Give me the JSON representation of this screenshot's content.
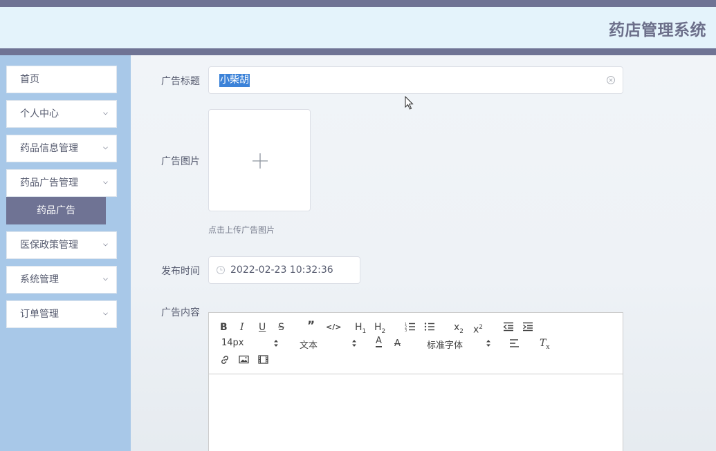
{
  "header": {
    "title": "药店管理系统"
  },
  "sidebar": {
    "items": [
      {
        "label": "首页",
        "expandable": false
      },
      {
        "label": "个人中心",
        "expandable": true
      },
      {
        "label": "药品信息管理",
        "expandable": true
      },
      {
        "label": "药品广告管理",
        "expandable": true
      },
      {
        "label": "医保政策管理",
        "expandable": true
      },
      {
        "label": "系统管理",
        "expandable": true
      },
      {
        "label": "订单管理",
        "expandable": true
      }
    ],
    "active_sub": {
      "label": "药品广告"
    }
  },
  "form": {
    "title_label": "广告标题",
    "title_value": "小柴胡",
    "image_label": "广告图片",
    "image_hint": "点击上传广告图片",
    "time_label": "发布时间",
    "time_value": "2022-02-23 10:32:36",
    "content_label": "广告内容"
  },
  "editor": {
    "font_size": "14px",
    "header_type": "文本",
    "font_family": "标准字体",
    "tools": [
      "bold-icon",
      "italic-icon",
      "underline-icon",
      "strikethrough-icon",
      "blockquote-icon",
      "code-block-icon",
      "h1-icon",
      "h2-icon",
      "ordered-list-icon",
      "bullet-list-icon",
      "subscript-icon",
      "superscript-icon",
      "outdent-icon",
      "indent-icon",
      "font-color-icon",
      "background-color-icon",
      "align-icon",
      "clear-format-icon",
      "link-icon",
      "image-icon",
      "video-icon"
    ]
  },
  "colors": {
    "accent": "#6f7394",
    "header_bg": "#e4f3fb",
    "sidebar_bg": "#a8c8e8",
    "selection": "#3b82d8"
  }
}
